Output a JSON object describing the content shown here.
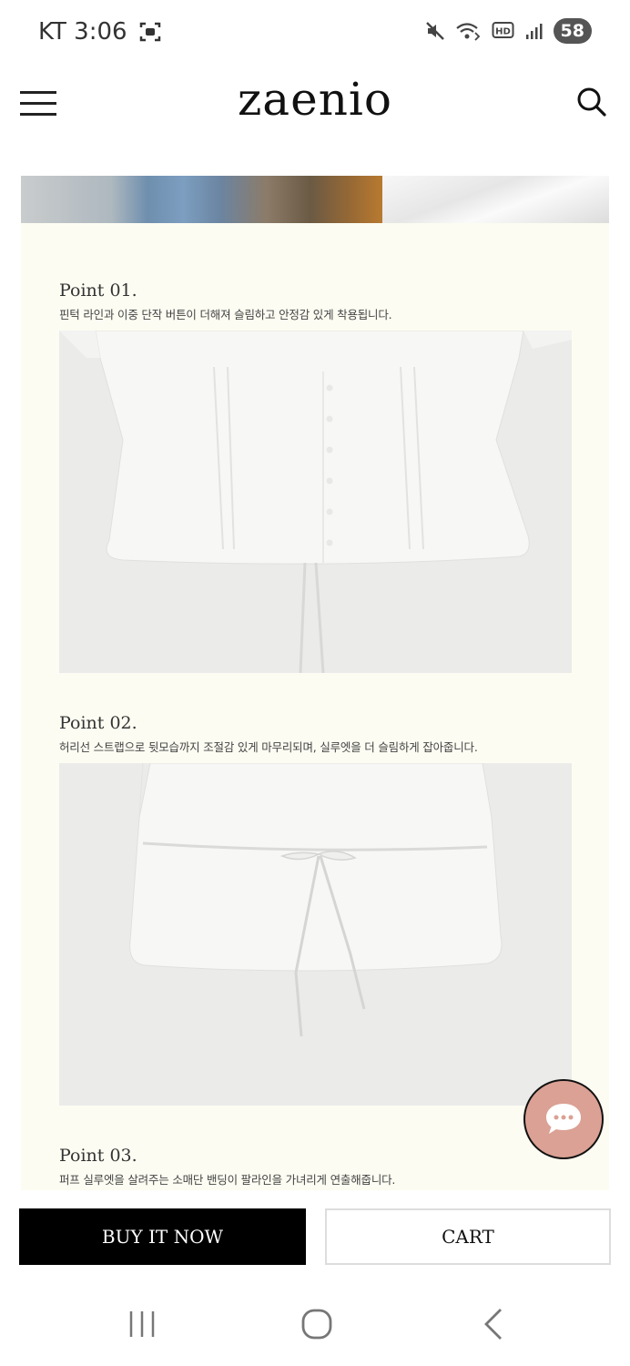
{
  "status_bar": {
    "carrier_time": "KT 3:06",
    "battery": "58",
    "icons": [
      "screenshot-icon",
      "mute-icon",
      "wifi-icon",
      "hd-icon",
      "signal-icon"
    ]
  },
  "header": {
    "logo": "zaenio",
    "menu_icon": "hamburger-menu-icon",
    "search_icon": "search-icon"
  },
  "points": [
    {
      "title": "Point 01.",
      "desc": "핀턱 라인과 이중 단작 버튼이 더해져 슬림하고 안정감 있게 착용됩니다."
    },
    {
      "title": "Point 02.",
      "desc": "허리선 스트랩으로 뒷모습까지 조절감 있게 마무리되며, 실루엣을 더 슬림하게 잡아줍니다."
    },
    {
      "title": "Point 03.",
      "desc": "퍼프 실루엣을 살려주는 소매단 밴딩이 팔라인을 가녀리게 연출해줍니다."
    }
  ],
  "actions": {
    "buy_label": "BUY IT NOW",
    "cart_label": "CART"
  },
  "colors": {
    "content_bg": "#fcfcf2",
    "chat_bg": "#dba194",
    "buy_bg": "#000000"
  }
}
